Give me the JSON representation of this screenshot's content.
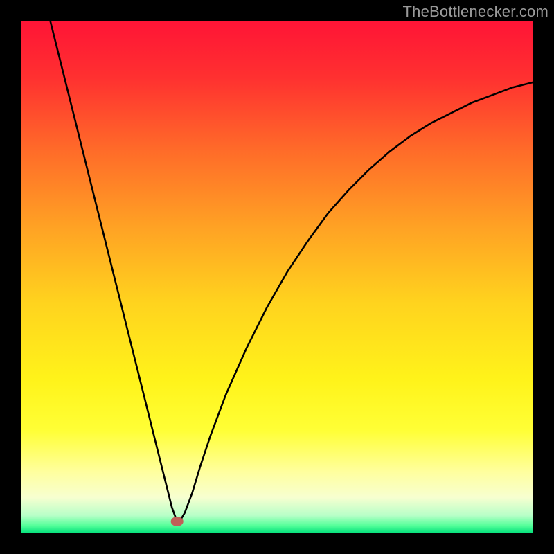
{
  "watermark": "TheBottlenecker.com",
  "chart_data": {
    "type": "line",
    "title": "",
    "xlabel": "",
    "ylabel": "",
    "xlim": [
      0,
      100
    ],
    "ylim": [
      0,
      100
    ],
    "gradient_stops": [
      {
        "offset": 0,
        "color": "#ff1436"
      },
      {
        "offset": 0.11,
        "color": "#ff3030"
      },
      {
        "offset": 0.25,
        "color": "#ff6a29"
      },
      {
        "offset": 0.4,
        "color": "#ffa124"
      },
      {
        "offset": 0.55,
        "color": "#ffd31e"
      },
      {
        "offset": 0.7,
        "color": "#fff31a"
      },
      {
        "offset": 0.8,
        "color": "#ffff36"
      },
      {
        "offset": 0.88,
        "color": "#ffff9e"
      },
      {
        "offset": 0.93,
        "color": "#f7ffd0"
      },
      {
        "offset": 0.965,
        "color": "#b8ffc8"
      },
      {
        "offset": 0.985,
        "color": "#55ff9a"
      },
      {
        "offset": 1.0,
        "color": "#00e07a"
      }
    ],
    "marker": {
      "x": 30.5,
      "y": 2.3,
      "color": "#c06058"
    },
    "series": [
      {
        "name": "curve",
        "x": [
          5,
          7,
          9,
          11,
          13,
          15,
          17,
          19,
          21,
          23,
          25,
          27,
          28.5,
          29.5,
          30.5,
          31,
          32,
          33.5,
          35,
          37,
          40,
          44,
          48,
          52,
          56,
          60,
          64,
          68,
          72,
          76,
          80,
          84,
          88,
          92,
          96,
          100
        ],
        "y": [
          103,
          95,
          87,
          79,
          71,
          63,
          55,
          47,
          39,
          31,
          23,
          15,
          9,
          5,
          2.3,
          2.3,
          4,
          8,
          13,
          19,
          27,
          36,
          44,
          51,
          57,
          62.5,
          67,
          71,
          74.5,
          77.5,
          80,
          82,
          84,
          85.5,
          87,
          88
        ]
      }
    ]
  }
}
